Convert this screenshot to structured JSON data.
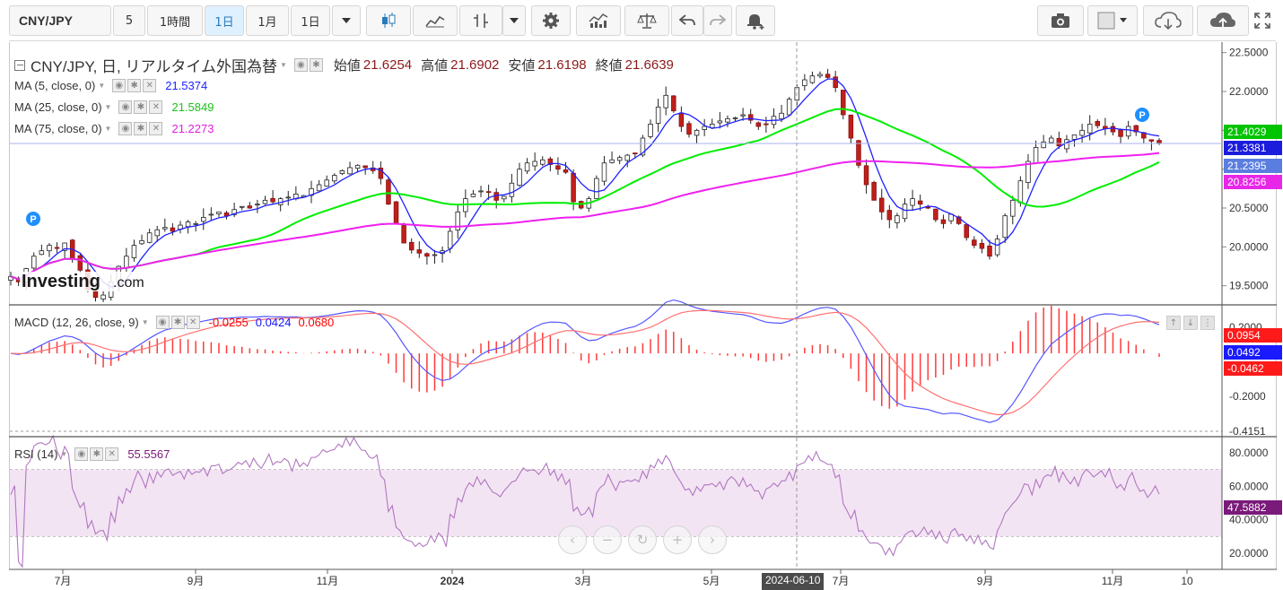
{
  "toolbar": {
    "symbol": "CNY/JPY",
    "interval_num": "5",
    "interval_hour": "1時間",
    "interval_day": "1日",
    "interval_month": "1月",
    "range": "1日"
  },
  "chart_data": {
    "type": "candlestick",
    "title": "CNY/JPY, 日, リアルタイム外国為替",
    "ohlc": {
      "open_label": "始値",
      "open": "21.6254",
      "high_label": "高値",
      "high": "21.6902",
      "low_label": "安値",
      "low": "21.6198",
      "close_label": "終値",
      "close": "21.6639"
    },
    "x_ticks": [
      "7月",
      "9月",
      "11月",
      "2024",
      "3月",
      "5月",
      "7月",
      "9月",
      "11月",
      "10"
    ],
    "crosshair_date": "2024-06-10",
    "price_axis": {
      "ticks": [
        "22.5000",
        "22.0000",
        "21.5000",
        "21.0000",
        "20.5000",
        "20.0000",
        "19.5000"
      ],
      "range": [
        19.3,
        22.6
      ]
    },
    "price": {
      "name": "CNY/JPY",
      "close": [
        19.62,
        19.55,
        19.72,
        19.88,
        19.95,
        20.02,
        19.98,
        20.05,
        19.85,
        19.7,
        19.45,
        19.35,
        19.38,
        19.55,
        19.75,
        19.88,
        20.02,
        20.08,
        20.18,
        20.22,
        20.25,
        20.2,
        20.28,
        20.32,
        20.3,
        20.38,
        20.42,
        20.45,
        20.4,
        20.48,
        20.52,
        20.5,
        20.55,
        20.6,
        20.58,
        20.62,
        20.64,
        20.68,
        20.66,
        20.75,
        20.8,
        20.86,
        20.92,
        20.98,
        21.02,
        21.05,
        21.02,
        20.98,
        20.88,
        20.55,
        20.3,
        20.05,
        19.96,
        19.92,
        19.88,
        19.9,
        19.95,
        20.2,
        20.45,
        20.62,
        20.68,
        20.72,
        20.7,
        20.6,
        20.65,
        20.82,
        21.0,
        21.08,
        21.1,
        21.12,
        21.06,
        21.0,
        20.96,
        20.58,
        20.5,
        20.62,
        20.88,
        21.08,
        21.12,
        21.15,
        21.18,
        21.2,
        21.4,
        21.58,
        21.8,
        21.95,
        21.75,
        21.55,
        21.45,
        21.5,
        21.55,
        21.58,
        21.62,
        21.65,
        21.66,
        21.7,
        21.63,
        21.55,
        21.58,
        21.68,
        21.72,
        21.9,
        22.05,
        22.15,
        22.2,
        22.22,
        22.18,
        22.05,
        21.7,
        21.4,
        21.05,
        20.8,
        20.6,
        20.45,
        20.35,
        20.4,
        20.55,
        20.62,
        20.55,
        20.5,
        20.35,
        20.3,
        20.42,
        20.3,
        20.12,
        20.02,
        19.98,
        19.88,
        20.1,
        20.4,
        20.6,
        20.85,
        21.1,
        21.28,
        21.35,
        21.4,
        21.3,
        21.38,
        21.44,
        21.5,
        21.58,
        21.56,
        21.52,
        21.48,
        21.42,
        21.55,
        21.48,
        21.4,
        21.36,
        21.34
      ],
      "ma_series": [
        {
          "name": "MA (5, close, 0)",
          "label": "MA (5, close, 0)",
          "value": "21.5374",
          "color": "#1f22ff",
          "period": 5
        },
        {
          "name": "MA (25, close, 0)",
          "label": "MA (25, close, 0)",
          "value": "21.5849",
          "color": "#00ee00",
          "period": 25
        },
        {
          "name": "MA (75, close, 0)",
          "label": "MA (75, close, 0)",
          "value": "21.2273",
          "color": "#f020f0",
          "period": 75
        }
      ],
      "axis_tags": [
        {
          "value": "21.4029",
          "color": "#00c400",
          "price": 21.4029
        },
        {
          "value": "21.3381",
          "color": "#1c1cdc",
          "price": 21.3381
        },
        {
          "value": "21.2395",
          "color": "#5a7ee0",
          "price": 21.2395
        },
        {
          "value": "20.8256",
          "color": "#e826e8",
          "price": 20.8256
        }
      ],
      "markers": [
        "P",
        "P"
      ]
    },
    "macd": {
      "label": "MACD (12, 26, close, 9)",
      "values": [
        "-0.0255",
        "0.0424",
        "0.0680"
      ],
      "value_colors": [
        "#ff0000",
        "#1414ff",
        "#ff0000"
      ],
      "ticks": [
        "0.2000",
        "-0.2000",
        "-0.4151"
      ],
      "range": [
        -0.43,
        0.24
      ],
      "axis_tags": [
        {
          "value": "0.0954",
          "color": "#ff1a1a",
          "level": 0.0954
        },
        {
          "value": "0.0492",
          "color": "#1a1aff",
          "level": 0.0492
        },
        {
          "value": "-0.0462",
          "color": "#ff1a1a",
          "level": -0.0462
        }
      ]
    },
    "rsi": {
      "label": "RSI (14)",
      "value": "55.5567",
      "ticks": [
        "80.0000",
        "60.0000",
        "40.0000",
        "20.0000"
      ],
      "range": [
        12,
        88
      ],
      "band": [
        30,
        70
      ],
      "axis_tag": {
        "value": "47.5882",
        "color": "#7a1a7a",
        "level": 47.5882
      }
    }
  }
}
